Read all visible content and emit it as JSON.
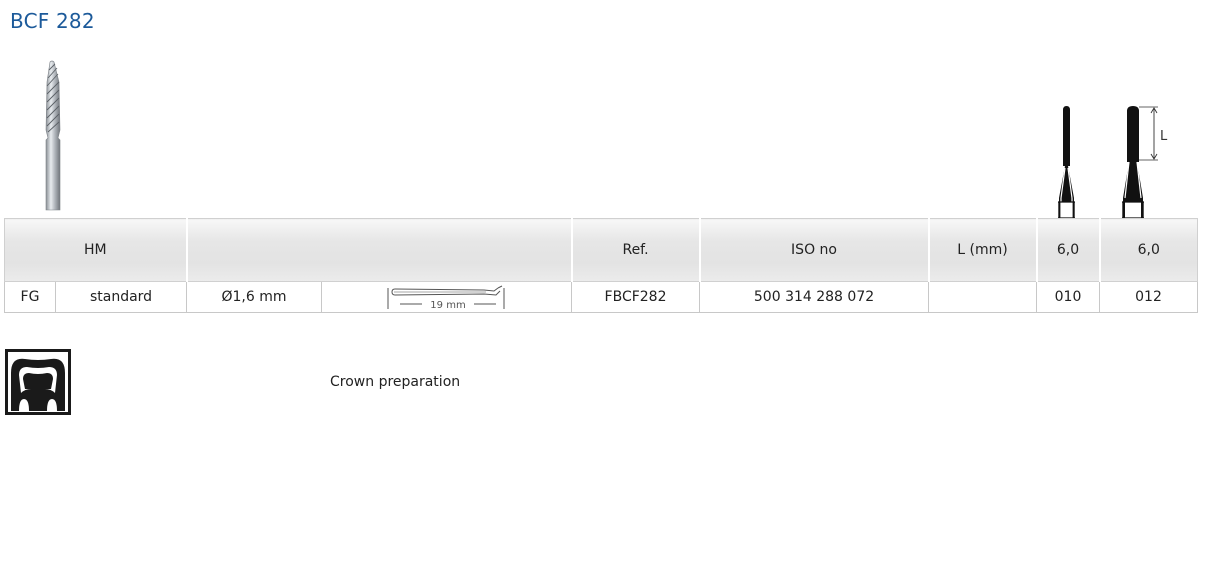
{
  "product": {
    "title": "BCF 282"
  },
  "table": {
    "header": {
      "material": "HM",
      "ref": "Ref.",
      "iso": "ISO no",
      "length": "L (mm)",
      "size1": "6,0",
      "size2": "6,0"
    },
    "row": {
      "shank": "FG",
      "type": "standard",
      "diameter": "Ø1,6 mm",
      "drawing_label": "19 mm",
      "ref": "FBCF282",
      "iso": "500 314 288 072",
      "length": "",
      "size1": "010",
      "size2": "012"
    }
  },
  "diagram": {
    "length_marker": "L"
  },
  "indication": {
    "icon": "crown-preparation-icon",
    "label": "Crown preparation"
  },
  "colors": {
    "title": "#1c5a9a",
    "header_bg": "#e6e6e6"
  }
}
